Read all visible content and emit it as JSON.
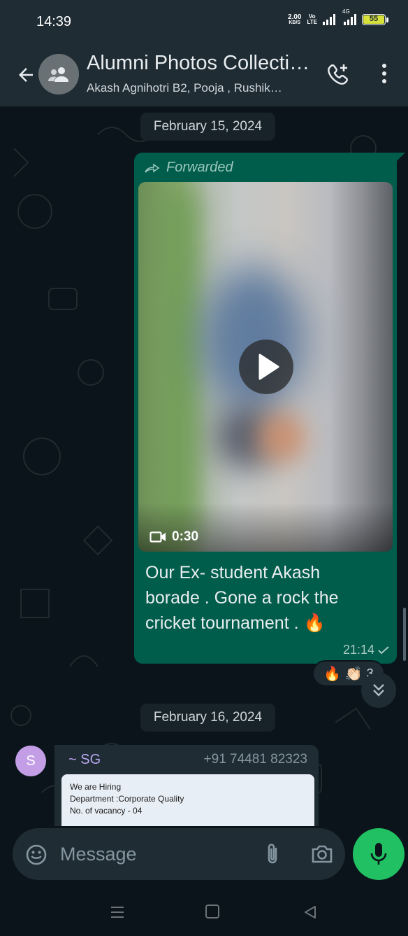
{
  "status_bar": {
    "time": "14:39",
    "net_speed_value": "2.00",
    "net_speed_unit": "KB/S",
    "volte_line1": "Vo",
    "volte_line2": "LTE",
    "net_type": "4G",
    "battery": "55"
  },
  "header": {
    "title": "Alumni Photos Collecti…",
    "subtitle": "Akash Agnihotri B2, Pooja , Rushik…"
  },
  "messages": [
    {
      "date": "February 15, 2024",
      "forwarded_label": "Forwarded",
      "video_duration": "0:30",
      "caption": "Our Ex- student Akash borade . Gone a rock the cricket tournament . 🔥",
      "time": "21:14",
      "reactions": "🔥 👏🏻",
      "reaction_count": "3"
    },
    {
      "date": "February 16, 2024",
      "sender_initial": "S",
      "sender_name": "~ SG",
      "sender_phone": "+91 74481 82323",
      "image_text": [
        "We are Hiring",
        "Department :Corporate Quality",
        "No. of vacancy - 04"
      ]
    }
  ],
  "input": {
    "placeholder": "Message"
  }
}
